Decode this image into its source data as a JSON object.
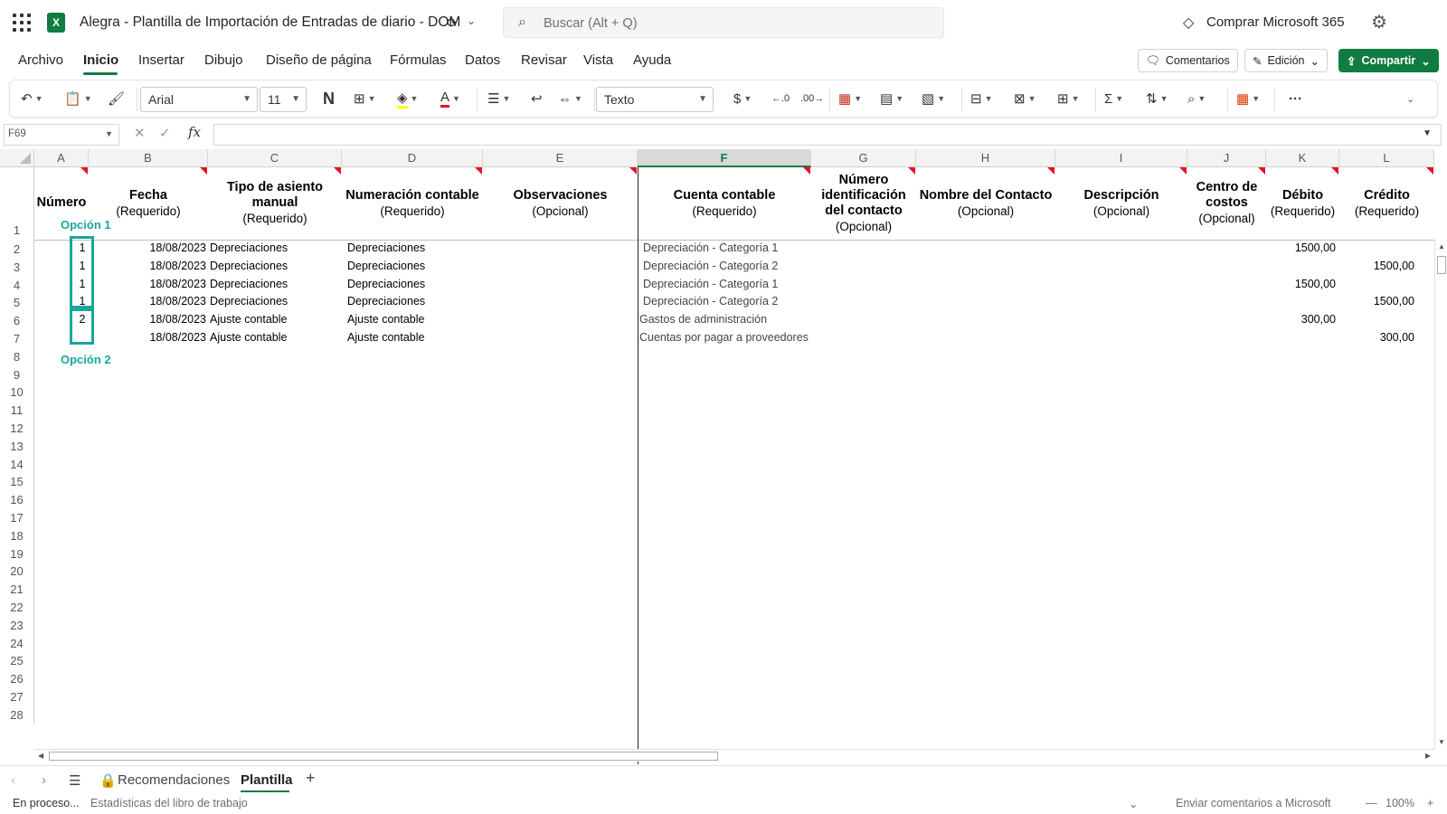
{
  "titlebar": {
    "app_title": "Alegra - Plantilla de Importación de Entradas de diario - DOM",
    "search_placeholder": "Buscar (Alt + Q)",
    "buy_label": "Comprar Microsoft 365"
  },
  "menu": {
    "tabs": [
      "Archivo",
      "Inicio",
      "Insertar",
      "Dibujo",
      "Diseño de página",
      "Fórmulas",
      "Datos",
      "Revisar",
      "Vista",
      "Ayuda"
    ],
    "active_tab": "Inicio",
    "comments_label": "Comentarios",
    "editing_label": "Edición",
    "share_label": "Compartir"
  },
  "ribbon": {
    "font_name": "Arial",
    "font_size": "11",
    "bold_label": "N",
    "number_format": "Texto"
  },
  "formula_bar": {
    "name_box": "F69",
    "fx_label": "fx",
    "formula": ""
  },
  "sheet": {
    "column_letters": [
      "A",
      "B",
      "C",
      "D",
      "E",
      "F",
      "G",
      "H",
      "I",
      "J",
      "K",
      "L"
    ],
    "selected_column": "F",
    "row_numbers": [
      "1",
      "2",
      "3",
      "4",
      "5",
      "6",
      "7",
      "8",
      "9",
      "10",
      "11",
      "12",
      "13",
      "14",
      "15",
      "16",
      "17",
      "18",
      "19",
      "20",
      "21",
      "22",
      "23",
      "24",
      "25",
      "26",
      "27",
      "28"
    ],
    "headers": [
      {
        "title": "Número",
        "sub": ""
      },
      {
        "title": "Fecha",
        "sub": "(Requerido)"
      },
      {
        "title": "Tipo de asiento manual",
        "sub": "(Requerido)"
      },
      {
        "title": "Numeración contable",
        "sub": "(Requerido)"
      },
      {
        "title": "Observaciones",
        "sub": "(Opcional)"
      },
      {
        "title": "Cuenta contable",
        "sub": "(Requerido)"
      },
      {
        "title": "Número identificación del contacto",
        "sub": "(Opcional)"
      },
      {
        "title": "Nombre del Contacto",
        "sub": "(Opcional)"
      },
      {
        "title": "Descripción",
        "sub": "(Opcional)"
      },
      {
        "title": "Centro de costos",
        "sub": "(Opcional)"
      },
      {
        "title": "Débito",
        "sub": "(Requerido)"
      },
      {
        "title": "Crédito",
        "sub": "(Requerido)"
      }
    ],
    "rows": [
      {
        "numero": "1",
        "fecha": "18/08/2023",
        "tipo": "Depreciaciones",
        "numeracion": "Depreciaciones",
        "cuenta": "Depreciación - Categoría 1",
        "debito": "1500,00",
        "credito": ""
      },
      {
        "numero": "1",
        "fecha": "18/08/2023",
        "tipo": "Depreciaciones",
        "numeracion": "Depreciaciones",
        "cuenta": "Depreciación - Categoría 2",
        "debito": "",
        "credito": "1500,00"
      },
      {
        "numero": "1",
        "fecha": "18/08/2023",
        "tipo": "Depreciaciones",
        "numeracion": "Depreciaciones",
        "cuenta": "Depreciación - Categoría 1",
        "debito": "1500,00",
        "credito": ""
      },
      {
        "numero": "1",
        "fecha": "18/08/2023",
        "tipo": "Depreciaciones",
        "numeracion": "Depreciaciones",
        "cuenta": "Depreciación - Categoría 2",
        "debito": "",
        "credito": "1500,00"
      },
      {
        "numero": "2",
        "fecha": "18/08/2023",
        "tipo": "Ajuste contable",
        "numeracion": "Ajuste contable",
        "cuenta": "Gastos de administración",
        "debito": "300,00",
        "credito": ""
      },
      {
        "numero": "",
        "fecha": "18/08/2023",
        "tipo": "Ajuste contable",
        "numeracion": "Ajuste contable",
        "cuenta": "Cuentas por pagar a proveedores",
        "debito": "",
        "credito": "300,00"
      }
    ],
    "annotations": {
      "option1": "Opción 1",
      "option2": "Opción 2",
      "highlight_color": "#1ba79d"
    }
  },
  "sheet_tabs": {
    "tabs": [
      "Recomendaciones",
      "Plantilla"
    ],
    "active": "Plantilla"
  },
  "status": {
    "left": "En proceso...",
    "workbook_stats": "Estadísticas del libro de trabajo",
    "feedback": "Enviar comentarios a Microsoft",
    "zoom": "100%"
  },
  "colors": {
    "accent": "#107c41",
    "comment_marker": "#e81123"
  },
  "icons": [
    "waffle-icon",
    "excel-logo-icon",
    "search-icon",
    "diamond-icon",
    "settings-icon",
    "undo-icon",
    "paste-icon",
    "format-painter-icon",
    "borders-icon",
    "fill-color-icon",
    "font-color-icon",
    "align-icon",
    "wrap-icon",
    "merge-icon",
    "currency-icon",
    "decrease-decimal-icon",
    "increase-decimal-icon",
    "conditional-format-icon",
    "format-table-icon",
    "cell-styles-icon",
    "insert-icon",
    "delete-icon",
    "format-icon",
    "sum-icon",
    "sort-filter-icon",
    "find-icon",
    "addins-icon",
    "more-icon",
    "lock-icon"
  ]
}
